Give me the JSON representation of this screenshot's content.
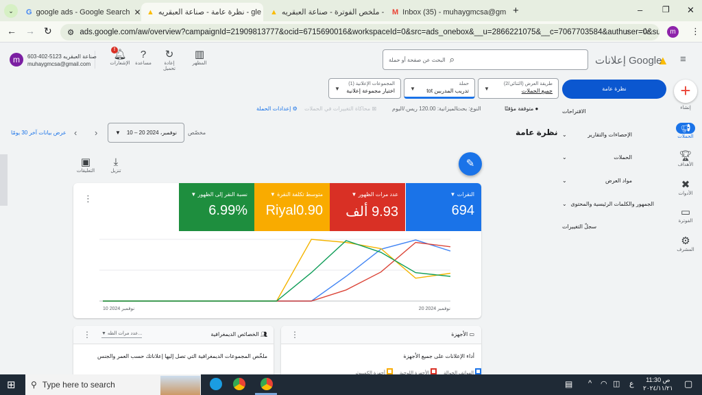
{
  "browser": {
    "tabs": [
      {
        "title": "google ads - Google Search",
        "icon": "google-icon"
      },
      {
        "title": "نظرة عامة - صناعة العبقريه - gle",
        "icon": "google-ads-icon"
      },
      {
        "title": "ملخص الفوترة - صناعة العبقريه -",
        "icon": "google-ads-icon"
      },
      {
        "title": "Inbox (35) - muhaygmcsa@gm",
        "icon": "gmail-icon"
      }
    ],
    "url": "ads.google.com/aw/overview?campaignId=21909813777&ocid=6715690016&workspaceId=0&src=ads_onebox&__u=2866221075&__c=7067703584&authuser=0&sub...",
    "profile_initial": "m"
  },
  "header": {
    "product": "إعلانات Google",
    "search_placeholder": "البحث عن صفحة أو حملة",
    "icons": [
      {
        "label": "المظهر"
      },
      {
        "label": "إعادة تحميل"
      },
      {
        "label": "مساعدة"
      },
      {
        "label": "الإشعارات"
      }
    ],
    "account_line1": "603-402-5123 صناعة العبقريه",
    "account_line2": "muhaygmcsa@gmail.com",
    "avatar": "m"
  },
  "filters": {
    "view": {
      "label": "طريقة العرض (الثنائي/2)",
      "value": "جميع الحملات"
    },
    "campaign": {
      "label": "حملة",
      "value": "تدريب المدربين tot"
    },
    "adgroup": {
      "label": "المجموعات الإعلانية (1)",
      "value": "اختيار مجموعة إعلانية"
    }
  },
  "status_bar": {
    "status": "متوقفة مؤقتًا",
    "type": "النوع: بحث",
    "budget": "الميزانية: 120.00 ريس./اليوم",
    "simulate": "محاكاة التغييرات في الحملات",
    "settings": "إعدادات الحملة"
  },
  "create_label": "إنشاء",
  "nav": {
    "overview": "نظرة عامة",
    "items": [
      "الاقتراحات",
      "الإحصاءات والتقارير",
      "الحملات",
      "مواد العرض",
      "الجمهور والكلمات الرئيسية والمحتوى",
      "سجلّ التغييرات"
    ]
  },
  "rail": [
    "الحملات",
    "الأهداف",
    "الأدوات",
    "الفوترة",
    "المشرف"
  ],
  "page": {
    "title": "نظرة عامة",
    "date_label": "مخصّص",
    "date_range": "10 – 20 نوفمبر، 2024",
    "last30": "عرض بيانات آخر 30 يومًا",
    "download": "تنزيل",
    "comments": "التعليقات"
  },
  "scorecards": [
    {
      "label": "النقرات",
      "value": "694",
      "color": "#1a73e8"
    },
    {
      "label": "عدد مرات الظهور",
      "value": "9.93 ألف",
      "color": "#d93025"
    },
    {
      "label": "متوسط تكلفة النقرة",
      "value": "Riyal0.90",
      "color": "#f9ab00"
    },
    {
      "label": "نسبة النقر إلى الظهور",
      "value": "6.99%",
      "color": "#1e8e3e"
    }
  ],
  "chart_data": {
    "type": "line",
    "x": [
      "10 نوفمبر 2024",
      "11",
      "12",
      "13",
      "14",
      "15",
      "16",
      "17",
      "18",
      "19",
      "20 نوفمبر 2024"
    ],
    "x_tick_labels": [
      "10 نوفمبر 2024",
      "20 نوفمبر 2024"
    ],
    "ylim": [
      0,
      100
    ],
    "series": [
      {
        "name": "النقرات",
        "color": "#4285f4",
        "values": [
          0,
          0,
          0,
          0,
          0,
          0,
          0,
          40,
          84,
          99,
          81
        ]
      },
      {
        "name": "عدد مرات الظهور",
        "color": "#db4437",
        "values": [
          0,
          0,
          0,
          0,
          0,
          0,
          0,
          18,
          47,
          95,
          88
        ]
      },
      {
        "name": "متوسط تكلفة النقرة",
        "color": "#f4b400",
        "values": [
          0,
          0,
          0,
          0,
          0,
          0,
          100,
          95,
          85,
          37,
          45
        ]
      },
      {
        "name": "نسبة النقر إلى الظهور",
        "color": "#0f9d58",
        "values": [
          0,
          0,
          0,
          0,
          0,
          0,
          46,
          98,
          79,
          46,
          40
        ]
      }
    ]
  },
  "devices_card": {
    "title": "الأجهزة",
    "subtitle": "أداء الإعلانات على جميع الأجهزة",
    "legend": [
      "الهواتف الجوالة",
      "الأجهزة اللوحية",
      "أجهزة الكمبيوتر"
    ]
  },
  "demo_card": {
    "title": "الخصائص الديمغرافية",
    "metric": "عدد مرات الظه...",
    "subtitle": "ملخّص المجموعات الديمغرافية التي تصل إليها إعلاناتك حسب العمر والجنس"
  },
  "taskbar": {
    "search": "Type here to search",
    "time": "11:30 ص",
    "date": "٢٠٢٤/١١/٢١",
    "lang": "ع"
  }
}
